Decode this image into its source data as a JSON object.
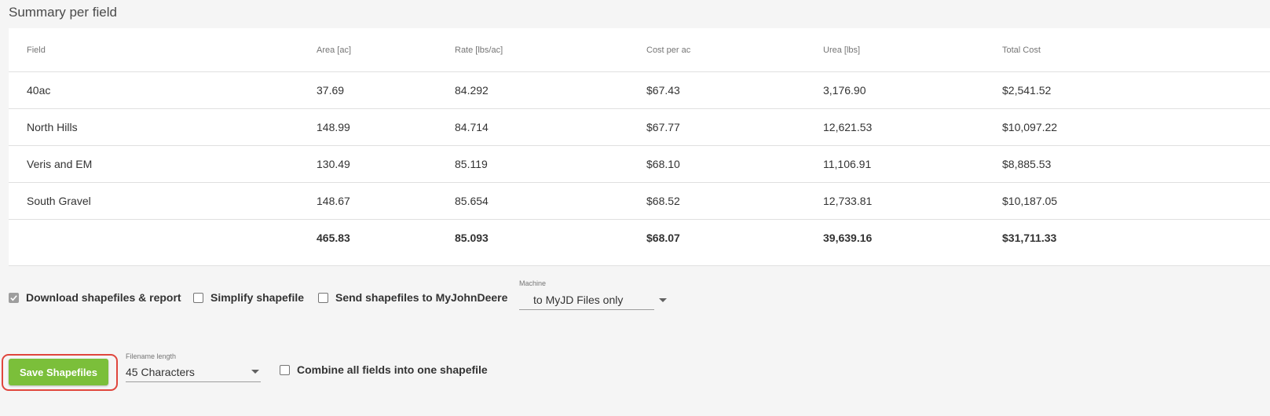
{
  "section_title": "Summary per field",
  "table": {
    "columns": [
      "Field",
      "Area [ac]",
      "Rate [lbs/ac]",
      "Cost per ac",
      "Urea [lbs]",
      "Total Cost"
    ],
    "rows": [
      [
        "40ac",
        "37.69",
        "84.292",
        "$67.43",
        "3,176.90",
        "$2,541.52"
      ],
      [
        "North Hills",
        "148.99",
        "84.714",
        "$67.77",
        "12,621.53",
        "$10,097.22"
      ],
      [
        "Veris and EM",
        "130.49",
        "85.119",
        "$68.10",
        "11,106.91",
        "$8,885.53"
      ],
      [
        "South Gravel",
        "148.67",
        "85.654",
        "$68.52",
        "12,733.81",
        "$10,187.05"
      ]
    ],
    "totals": [
      "",
      "465.83",
      "85.093",
      "$68.07",
      "39,639.16",
      "$31,711.33"
    ]
  },
  "options": {
    "download_label": "Download shapefiles & report",
    "download_checked": true,
    "simplify_label": "Simplify shapefile",
    "simplify_checked": false,
    "send_label": "Send shapefiles to MyJohnDeere",
    "send_checked": false,
    "machine_label": "Machine",
    "machine_value": "to MyJD Files only"
  },
  "actions": {
    "save_label": "Save Shapefiles",
    "filename_length_label": "Filename length",
    "filename_length_value": "45 Characters",
    "combine_label": "Combine all fields into one shapefile",
    "combine_checked": false
  },
  "colors": {
    "save_button": "#7bbf3a",
    "highlight_outline": "#e0463d",
    "checked_checkbox": "#9e9e9e"
  },
  "icons": {
    "checkbox_checked": "check-icon",
    "dropdown": "chevron-down-icon"
  }
}
